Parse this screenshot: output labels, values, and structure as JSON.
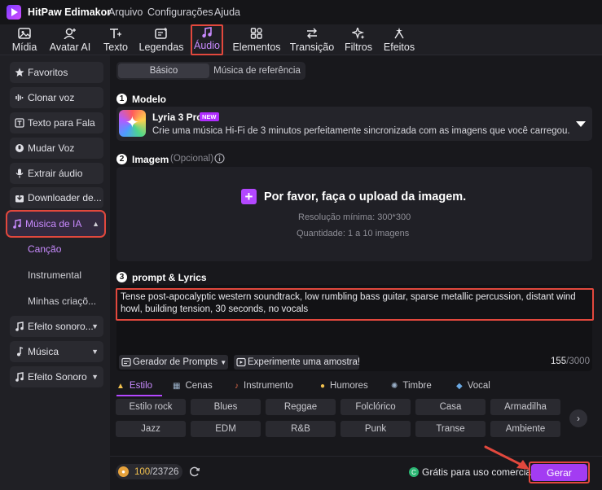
{
  "app": {
    "title": "HitPaw Edimakor",
    "menu": [
      "Arquivo",
      "Configurações",
      "Ajuda"
    ]
  },
  "toolbar": {
    "items": [
      {
        "label": "Mídia",
        "icon": "media-icon"
      },
      {
        "label": "Avatar AI",
        "icon": "avatar-icon"
      },
      {
        "label": "Texto",
        "icon": "text-icon"
      },
      {
        "label": "Legendas",
        "icon": "subtitles-icon"
      },
      {
        "label": "Áudio",
        "icon": "audio-icon",
        "active": true
      },
      {
        "label": "Elementos",
        "icon": "elements-icon"
      },
      {
        "label": "Transição",
        "icon": "transition-icon"
      },
      {
        "label": "Filtros",
        "icon": "filters-icon"
      },
      {
        "label": "Efeitos",
        "icon": "effects-icon"
      }
    ]
  },
  "sidebar": {
    "items": [
      {
        "label": "Favoritos",
        "icon": "star-icon"
      },
      {
        "label": "Clonar voz",
        "icon": "waveform-icon"
      },
      {
        "label": "Texto para Fala",
        "icon": "text-to-speech-icon"
      },
      {
        "label": "Mudar Voz",
        "icon": "voice-changer-icon"
      },
      {
        "label": "Extrair áudio",
        "icon": "microphone-icon"
      },
      {
        "label": "Downloader de...",
        "icon": "download-icon"
      },
      {
        "label": "Música de IA",
        "icon": "ai-music-icon",
        "active": true,
        "expanded": true
      }
    ],
    "subitems": [
      {
        "label": "Canção",
        "active": true
      },
      {
        "label": "Instrumental"
      },
      {
        "label": "Minhas criaçõ..."
      }
    ],
    "groups": [
      {
        "label": "Efeito sonoro...",
        "icon": "sound-effect-icon"
      },
      {
        "label": "Música",
        "icon": "music-note-icon"
      },
      {
        "label": "Efeito Sonoro",
        "icon": "sound-effect-icon"
      }
    ]
  },
  "tabs": {
    "basic": "Básico",
    "reference": "Música de referência"
  },
  "model": {
    "step": "1",
    "heading": "Modelo",
    "name": "Lyria 3 Pro",
    "badge": "NEW",
    "description": "Crie uma música Hi-Fi de 3 minutos perfeitamente sincronizada com as imagens que você carregou."
  },
  "image": {
    "step": "2",
    "heading": "Imagem",
    "optional": "(Opcional)",
    "upload_text": "Por favor, faça o upload da imagem.",
    "min_resolution": "Resolução mínima: 300*300",
    "quantity": "Quantidade: 1 a 10 imagens"
  },
  "prompt": {
    "step": "3",
    "heading": "prompt & Lyrics",
    "text": "Tense post-apocalyptic western soundtrack, low rumbling bass guitar, sparse metallic percussion, distant wind howl, building tension, 30 seconds, no vocals",
    "generator_label": "Gerador de Prompts",
    "sample_label": "Experimente uma amostra!",
    "count": "155",
    "max": "/3000"
  },
  "categories": [
    {
      "label": "Estilo",
      "active": true
    },
    {
      "label": "Cenas"
    },
    {
      "label": "Instrumento"
    },
    {
      "label": "Humores"
    },
    {
      "label": "Timbre"
    },
    {
      "label": "Vocal"
    }
  ],
  "chips": [
    [
      "Estilo rock",
      "Blues",
      "Reggae",
      "Folclórico",
      "Casa",
      "Armadilha"
    ],
    [
      "Jazz",
      "EDM",
      "R&B",
      "Punk",
      "Transe",
      "Ambiente"
    ]
  ],
  "footer": {
    "credits_used": "100",
    "credits_total": "/23726",
    "license": "Grátis para uso comercial",
    "generate": "Gerar"
  },
  "colors": {
    "accent": "#a33cf2",
    "highlight": "#e2483d"
  }
}
